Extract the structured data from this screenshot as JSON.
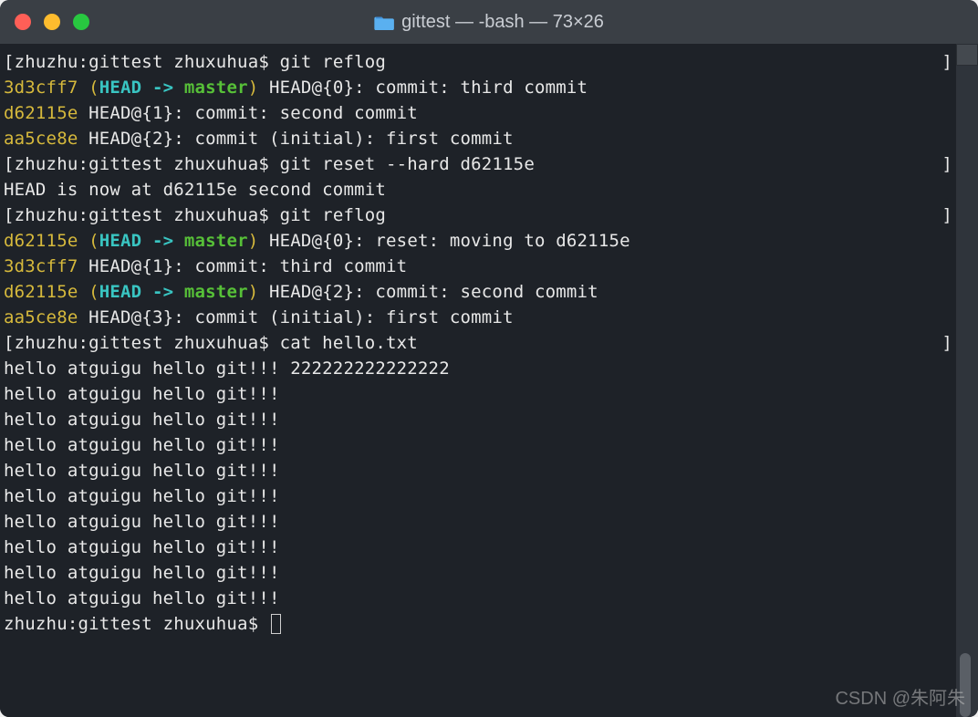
{
  "titlebar": {
    "title": "gittest — -bash — 73×26"
  },
  "colors": {
    "red": "#ff5f57",
    "yellow_btn": "#febc2e",
    "green_btn": "#28c840",
    "hash_yellow": "#d6b93c",
    "head_cyan": "#39c5c2",
    "branch_green": "#57c038",
    "text_white": "#e8e8e8",
    "bg": "#1e2228"
  },
  "prompt": {
    "host": "zhuzhu",
    "dir": "gittest",
    "user": "zhuxuhua",
    "full_open": "[zhuzhu:gittest zhuxuhua$ ",
    "close": "]",
    "plain": "zhuzhu:gittest zhuxuhua$ "
  },
  "commands": {
    "reflog1": "git reflog",
    "reset": "git reset --hard d62115e",
    "reflog2": "git reflog",
    "cat": "cat hello.txt"
  },
  "reflog1": [
    {
      "hash": "3d3cff7",
      "head": "HEAD -> ",
      "branch": "master",
      "rest": " HEAD@{0}: commit: third commit"
    },
    {
      "hash": "d62115e",
      "head": "",
      "branch": "",
      "rest": " HEAD@{1}: commit: second commit"
    },
    {
      "hash": "aa5ce8e",
      "head": "",
      "branch": "",
      "rest": " HEAD@{2}: commit (initial): first commit"
    }
  ],
  "reset_output": "HEAD is now at d62115e second commit",
  "reflog2": [
    {
      "hash": "d62115e",
      "head": "HEAD -> ",
      "branch": "master",
      "rest": " HEAD@{0}: reset: moving to d62115e"
    },
    {
      "hash": "3d3cff7",
      "head": "",
      "branch": "",
      "rest": " HEAD@{1}: commit: third commit"
    },
    {
      "hash": "d62115e",
      "head": "HEAD -> ",
      "branch": "master",
      "rest": " HEAD@{2}: commit: second commit"
    },
    {
      "hash": "aa5ce8e",
      "head": "",
      "branch": "",
      "rest": " HEAD@{3}: commit (initial): first commit"
    }
  ],
  "cat_output": [
    "hello atguigu hello git!!! 222222222222222",
    "hello atguigu hello git!!!",
    "hello atguigu hello git!!!",
    "hello atguigu hello git!!!",
    "hello atguigu hello git!!!",
    "hello atguigu hello git!!!",
    "hello atguigu hello git!!!",
    "hello atguigu hello git!!!",
    "hello atguigu hello git!!!",
    "hello atguigu hello git!!!"
  ],
  "watermark": "CSDN @朱阿朱"
}
